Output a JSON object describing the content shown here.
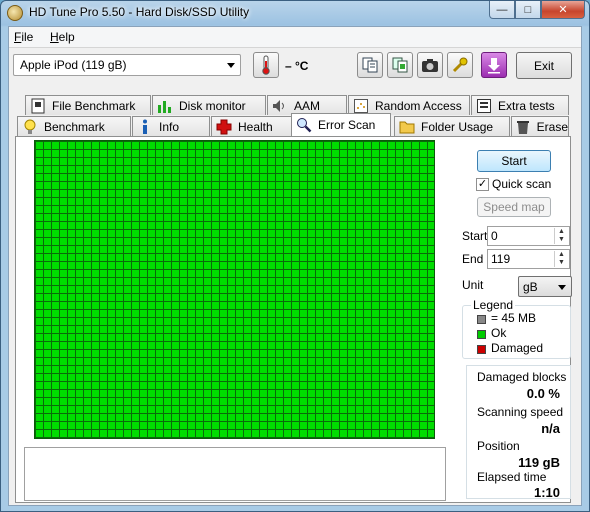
{
  "window": {
    "title": "HD Tune Pro 5.50 - Hard Disk/SSD Utility"
  },
  "menu": {
    "file": "File",
    "file_mnemonic": "F",
    "file_rest": "ile",
    "help_mnemonic": "H",
    "help_rest": "elp"
  },
  "toolbar": {
    "drive": "Apple   iPod (119 gB)",
    "temperature": "– °C",
    "exit_label": "Exit"
  },
  "tabs_row1": [
    "File Benchmark",
    "Disk monitor",
    "AAM",
    "Random Access",
    "Extra tests"
  ],
  "tabs_row2": [
    "Benchmark",
    "Info",
    "Health",
    "Error Scan",
    "Folder Usage",
    "Erase"
  ],
  "active_tab": "Error Scan",
  "controls": {
    "start_button": "Start",
    "quick_scan_label": "Quick scan",
    "quick_scan_checked": true,
    "speed_map_button": "Speed map",
    "start_label": "Start",
    "start_value": "0",
    "end_label": "End",
    "end_value": "119",
    "unit_label": "Unit",
    "unit_value": "gB"
  },
  "legend": {
    "title": "Legend",
    "block_size": "= 45 MB",
    "ok": "Ok",
    "damaged": "Damaged",
    "colors": {
      "block": "#888888",
      "ok": "#00cc00",
      "damaged": "#cc0000"
    }
  },
  "stats": {
    "damaged_blocks_label": "Damaged blocks",
    "damaged_blocks_value": "0.0 %",
    "scanning_speed_label": "Scanning speed",
    "scanning_speed_value": "n/a",
    "position_label": "Position",
    "position_value": "119 gB",
    "elapsed_time_label": "Elapsed time",
    "elapsed_time_value": "1:10"
  },
  "scan_grid": {
    "status": "Ok",
    "color": "#00dd00"
  }
}
